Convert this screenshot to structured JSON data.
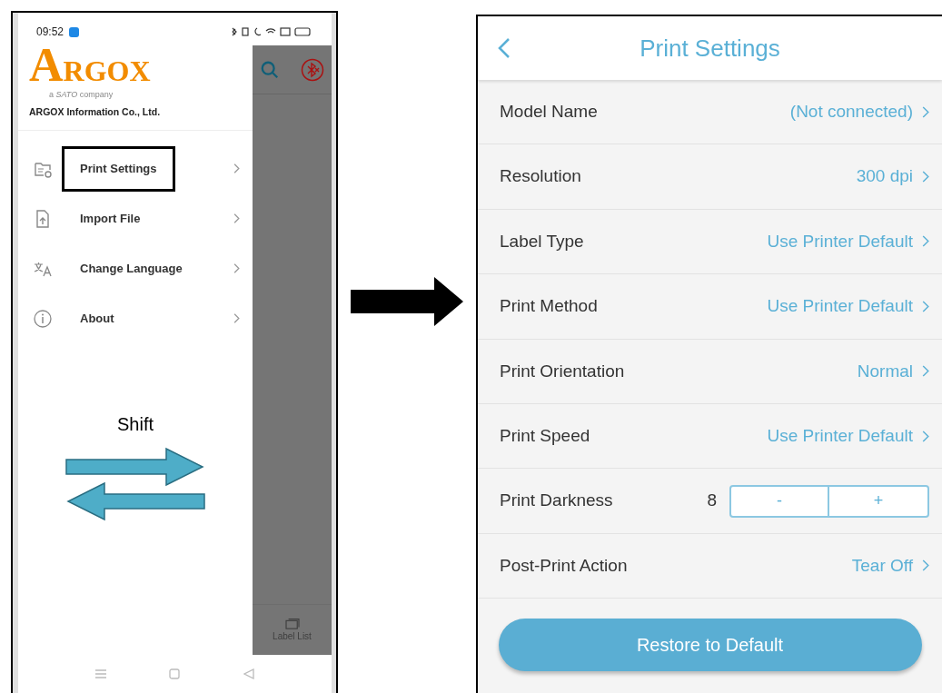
{
  "left_phone": {
    "status_bar": {
      "time": "09:52"
    },
    "drawer": {
      "logo": "ARGOX",
      "tagline": "a *SATO* company",
      "company": "ARGOX Information Co., Ltd.",
      "items": [
        {
          "label": "Print Settings",
          "highlighted": true
        },
        {
          "label": "Import File",
          "highlighted": false
        },
        {
          "label": "Change Language",
          "highlighted": false
        },
        {
          "label": "About",
          "highlighted": false
        }
      ]
    },
    "annotation": {
      "label": "Shift"
    },
    "background_tab": {
      "label": "Label List"
    }
  },
  "right_phone": {
    "title": "Print Settings",
    "rows": [
      {
        "kind": "link",
        "label": "Model Name",
        "value": "(Not connected)"
      },
      {
        "kind": "link",
        "label": "Resolution",
        "value": "300 dpi"
      },
      {
        "kind": "link",
        "label": "Label Type",
        "value": "Use Printer Default"
      },
      {
        "kind": "link",
        "label": "Print Method",
        "value": "Use Printer Default"
      },
      {
        "kind": "link",
        "label": "Print Orientation",
        "value": "Normal"
      },
      {
        "kind": "link",
        "label": "Print Speed",
        "value": "Use Printer Default"
      },
      {
        "kind": "stepper",
        "label": "Print Darkness",
        "value": "8",
        "decrease": "-",
        "increase": "+"
      },
      {
        "kind": "link",
        "label": "Post-Print Action",
        "value": "Tear Off"
      }
    ],
    "button": "Restore to Default"
  }
}
